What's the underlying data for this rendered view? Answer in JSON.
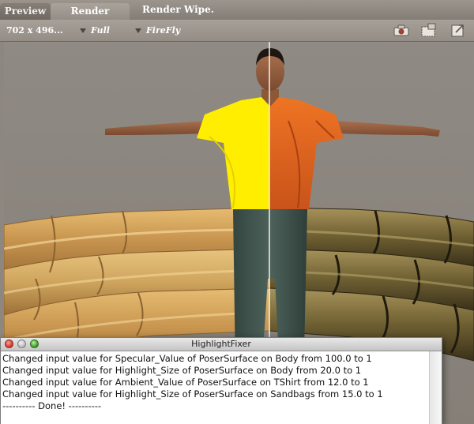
{
  "tabs": {
    "preview": "Preview",
    "render": "Render",
    "render_wipe": "Render Wipe."
  },
  "settings": {
    "size": "702 x 496...",
    "quality": "Full",
    "renderer": "FireFly"
  },
  "toolbar_icons": [
    "camera-icon",
    "render-settings-icon",
    "export-icon"
  ],
  "highlight_fixer": {
    "title": "HighlightFixer",
    "lines": [
      "Changed input value for Specular_Value of PoserSurface on Body from 100.0 to 1",
      "Changed input value for Highlight_Size of PoserSurface on Body from 20.0 to 1",
      "Changed input value for Ambient_Value of PoserSurface on TShirt from 12.0 to 1",
      "Changed input value for Highlight_Size of PoserSurface on Sandbags from 15.0 to 1",
      "---------- Done! ----------"
    ]
  },
  "colors": {
    "tshirt_left": "#ffee00",
    "tshirt_right": "#e8691a",
    "background": "#8d8780",
    "sandbag_left": "#d8a85c",
    "sandbag_right": "#7a6a3a"
  }
}
